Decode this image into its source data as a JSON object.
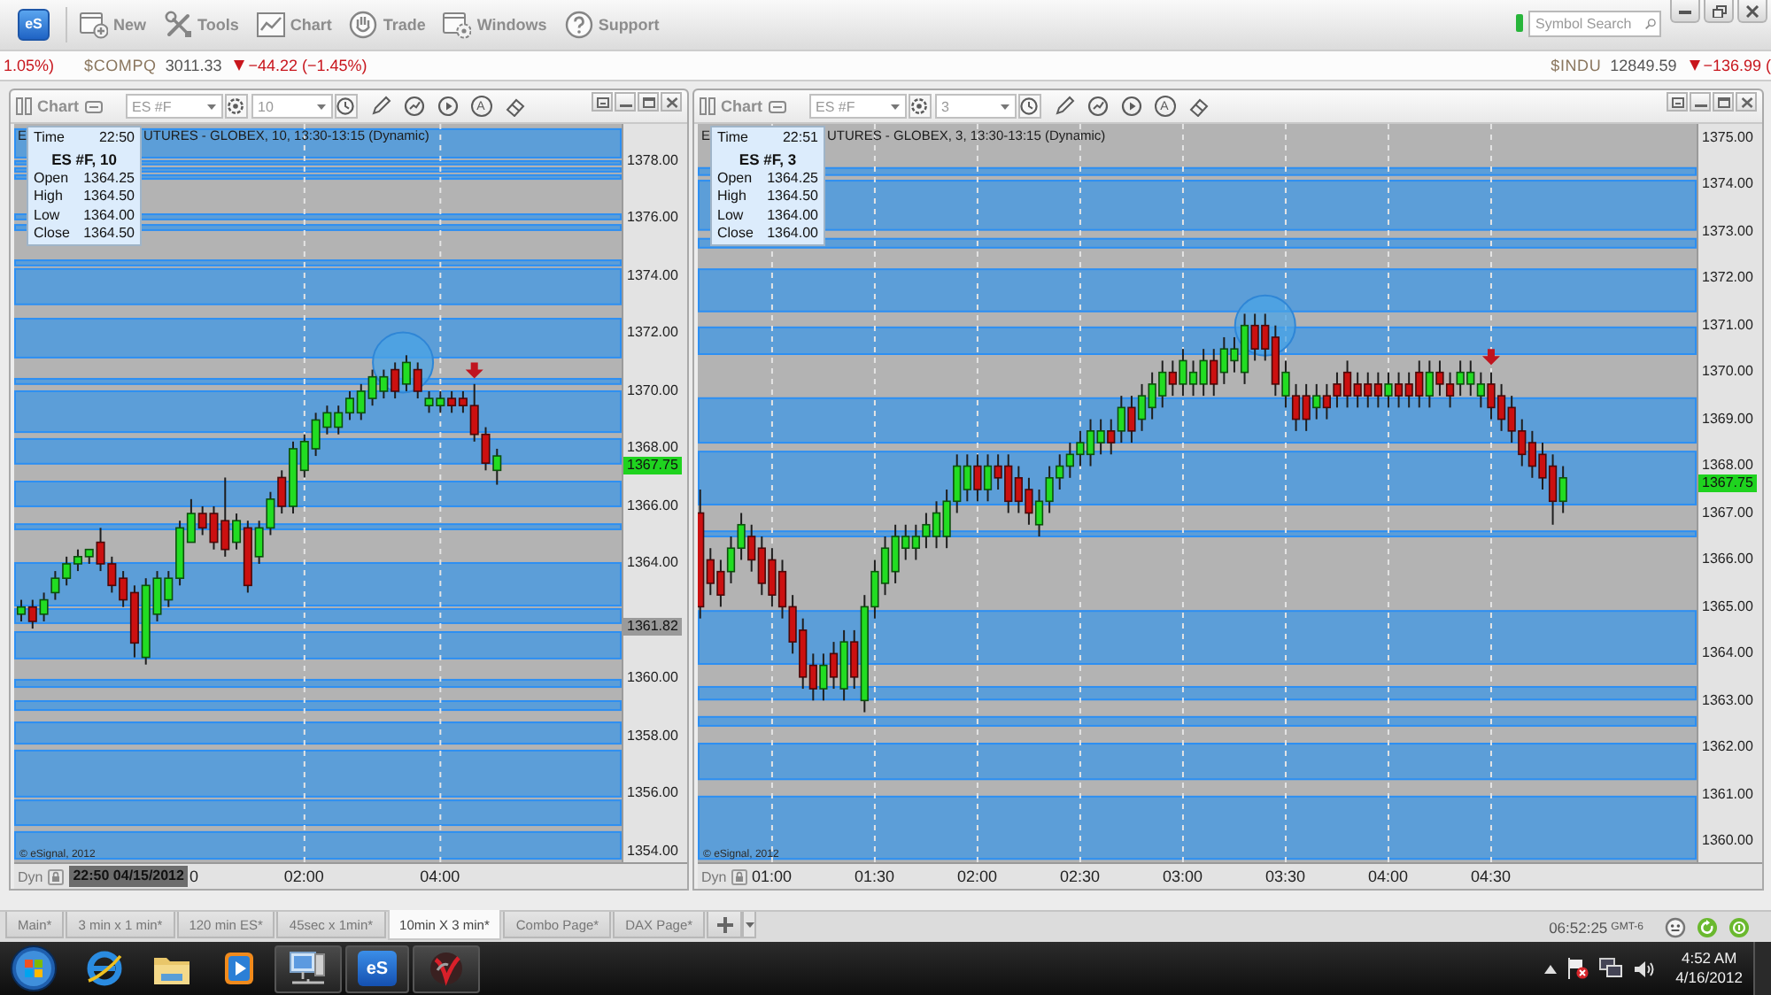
{
  "app_toolbar": {
    "logo": "eS",
    "buttons": [
      {
        "kind": "new",
        "label": "New"
      },
      {
        "kind": "tools",
        "label": "Tools"
      },
      {
        "kind": "chart",
        "label": "Chart"
      },
      {
        "kind": "trade",
        "label": "Trade"
      },
      {
        "kind": "windows",
        "label": "Windows"
      },
      {
        "kind": "support",
        "label": "Support"
      }
    ],
    "search": {
      "placeholder": "Symbol Search"
    }
  },
  "ticker": {
    "left": [
      {
        "kind": "tail",
        "text": "1.05%)",
        "down": true
      },
      {
        "kind": "quote",
        "symbol": "$COMPQ",
        "price": "3011.33",
        "change": "−44.22 (−1.45%)",
        "down": true
      }
    ],
    "right": [
      {
        "kind": "quote",
        "symbol": "$INDU",
        "price": "12849.59",
        "change": "−136.99 (",
        "down": true
      }
    ]
  },
  "charts": [
    {
      "header": {
        "label": "Chart",
        "symbol": "ES #F",
        "interval": "10",
        "text_tool": "A"
      },
      "title_start": "E",
      "title_rest": "UTURES - GLOBEX, 10, 13:30-13:15 (Dynamic)",
      "legend": {
        "time_label": "Time",
        "time": "22:50",
        "heading": "ES #F, 10",
        "rows": [
          {
            "label": "Open",
            "value": "1364.25"
          },
          {
            "label": "High",
            "value": "1364.50"
          },
          {
            "label": "Low",
            "value": "1364.00"
          },
          {
            "label": "Close",
            "value": "1364.50"
          }
        ]
      },
      "chart_data": {
        "type": "candlestick",
        "x": [
          -130,
          -120,
          -110,
          -100,
          -90,
          -80,
          -70,
          -60,
          -50,
          -40,
          -30,
          -20,
          -10,
          0,
          10,
          20,
          30,
          40,
          50,
          60,
          70,
          80,
          90,
          100,
          110,
          120,
          130,
          140,
          150,
          160,
          170,
          180,
          190,
          200,
          210,
          220,
          230,
          240,
          250,
          260,
          270,
          280,
          290
        ],
        "ohlc": [
          [
            1362.25,
            1362.75,
            1362,
            1362.5
          ],
          [
            1362.5,
            1362.75,
            1361.75,
            1362
          ],
          [
            1362.25,
            1363,
            1362,
            1362.75
          ],
          [
            1363,
            1363.75,
            1362.75,
            1363.5
          ],
          [
            1363.5,
            1364.25,
            1363.25,
            1364
          ],
          [
            1364,
            1364.5,
            1363.75,
            1364.25
          ],
          [
            1364.25,
            1364.5,
            1364,
            1364.5
          ],
          [
            1364.75,
            1365.25,
            1363.75,
            1364
          ],
          [
            1364,
            1364.25,
            1363,
            1363.25
          ],
          [
            1363.5,
            1363.75,
            1362.5,
            1362.75
          ],
          [
            1363,
            1363.25,
            1360.75,
            1361.25
          ],
          [
            1360.75,
            1363.5,
            1360.5,
            1363.25
          ],
          [
            1362.25,
            1363.75,
            1362,
            1363.5
          ],
          [
            1362.75,
            1363.75,
            1362.5,
            1363.5
          ],
          [
            1363.5,
            1365.5,
            1363.25,
            1365.25
          ],
          [
            1364.75,
            1366.25,
            1364.75,
            1365.75
          ],
          [
            1365.75,
            1366,
            1365,
            1365.25
          ],
          [
            1365.75,
            1366,
            1364.5,
            1364.75
          ],
          [
            1365.5,
            1367,
            1364.25,
            1364.5
          ],
          [
            1364.75,
            1365.75,
            1364.5,
            1365.5
          ],
          [
            1365.25,
            1365.5,
            1363,
            1363.25
          ],
          [
            1364.25,
            1365.5,
            1364,
            1365.25
          ],
          [
            1365.25,
            1366.5,
            1365,
            1366.25
          ],
          [
            1367,
            1367.25,
            1365.75,
            1366
          ],
          [
            1366,
            1368.25,
            1365.75,
            1368
          ],
          [
            1367.25,
            1368.5,
            1367,
            1368.25
          ],
          [
            1368,
            1369.25,
            1367.75,
            1369
          ],
          [
            1368.75,
            1369.5,
            1368.5,
            1369.25
          ],
          [
            1368.75,
            1369.5,
            1368.5,
            1369.25
          ],
          [
            1369.25,
            1370,
            1369,
            1369.75
          ],
          [
            1369.25,
            1370.25,
            1369,
            1370
          ],
          [
            1369.75,
            1370.75,
            1369.5,
            1370.5
          ],
          [
            1370,
            1370.75,
            1369.75,
            1370.5
          ],
          [
            1370.75,
            1371,
            1369.75,
            1370
          ],
          [
            1370.25,
            1371.25,
            1370,
            1371
          ],
          [
            1370.75,
            1371,
            1369.75,
            1370
          ],
          [
            1369.5,
            1370,
            1369.25,
            1369.75
          ],
          [
            1369.5,
            1370,
            1369.25,
            1369.75
          ],
          [
            1369.75,
            1370,
            1369.25,
            1369.5
          ],
          [
            1369.75,
            1370,
            1369.25,
            1369.5
          ],
          [
            1369.5,
            1370.25,
            1368.25,
            1368.5
          ],
          [
            1368.5,
            1368.75,
            1367.25,
            1367.5
          ],
          [
            1367.25,
            1368,
            1366.75,
            1367.75
          ]
        ],
        "xlim": [
          -136.25,
          457.84
        ],
        "ylim": [
          1353.63,
          1379.29
        ],
        "grid": true,
        "xticks": [
          {
            "value": 120,
            "label": "02:00"
          },
          {
            "value": 240,
            "label": "04:00"
          }
        ],
        "yticks": [
          {
            "value": 1378,
            "label": "1378.00"
          },
          {
            "value": 1376,
            "label": "1376.00"
          },
          {
            "value": 1374,
            "label": "1374.00"
          },
          {
            "value": 1372,
            "label": "1372.00"
          },
          {
            "value": 1370,
            "label": "1370.00"
          },
          {
            "value": 1368,
            "label": "1368.00"
          },
          {
            "value": 1366,
            "label": "1366.00"
          },
          {
            "value": 1364,
            "label": "1364.00"
          },
          {
            "value": 1361.82,
            "label": "1361.82"
          },
          {
            "value": 1360,
            "label": "1360.00"
          },
          {
            "value": 1358,
            "label": "1358.00"
          },
          {
            "value": 1356,
            "label": "1356.00"
          },
          {
            "value": 1354,
            "label": "1354.00"
          }
        ],
        "bands": [
          {
            "axis": "y",
            "from": 1378.12,
            "to": 1379.11
          },
          {
            "axis": "y",
            "from": 1377.88,
            "to": 1378.0
          },
          {
            "axis": "y",
            "from": 1377.63,
            "to": 1377.75
          },
          {
            "axis": "y",
            "from": 1377.38,
            "to": 1377.51
          },
          {
            "axis": "y",
            "from": 1375.97,
            "to": 1376.15
          },
          {
            "axis": "y",
            "from": 1375.6,
            "to": 1375.78
          },
          {
            "axis": "y",
            "from": 1374.37,
            "to": 1374.55
          },
          {
            "axis": "y",
            "from": 1373.02,
            "to": 1374.25
          },
          {
            "axis": "y",
            "from": 1371.17,
            "to": 1372.52
          },
          {
            "axis": "y",
            "from": 1370.25,
            "to": 1370.43
          },
          {
            "axis": "y",
            "from": 1368.58,
            "to": 1370.0
          },
          {
            "axis": "y",
            "from": 1367.48,
            "to": 1368.34
          },
          {
            "axis": "y",
            "from": 1366.0,
            "to": 1366.86
          },
          {
            "axis": "y",
            "from": 1365.2,
            "to": 1365.38
          },
          {
            "axis": "y",
            "from": 1362.55,
            "to": 1364.03
          },
          {
            "axis": "y",
            "from": 1361.94,
            "to": 1362.43
          },
          {
            "axis": "y",
            "from": 1360.71,
            "to": 1361.63
          },
          {
            "axis": "y",
            "from": 1359.72,
            "to": 1359.97
          },
          {
            "axis": "y",
            "from": 1358.92,
            "to": 1359.23
          },
          {
            "axis": "y",
            "from": 1357.75,
            "to": 1358.49
          },
          {
            "axis": "y",
            "from": 1355.91,
            "to": 1357.51
          },
          {
            "axis": "y",
            "from": 1354.92,
            "to": 1355.78
          },
          {
            "axis": "y",
            "from": 1353.75,
            "to": 1354.68
          }
        ],
        "annotations": [
          "1367.75"
        ]
      },
      "copyright": "© eSignal, 2012",
      "time_axis": {
        "mode": "Dyn",
        "cursor_time": "22:50 04/15/2012",
        "clipped_label": "0"
      }
    },
    {
      "header": {
        "label": "Chart",
        "symbol": "ES #F",
        "interval": "3",
        "text_tool": "A"
      },
      "title_start": "E",
      "title_rest": "UTURES - GLOBEX, 3, 13:30-13:15 (Dynamic)",
      "legend": {
        "time_label": "Time",
        "time": "22:51",
        "heading": "ES #F, 3",
        "rows": [
          {
            "label": "Open",
            "value": "1364.25"
          },
          {
            "label": "High",
            "value": "1364.50"
          },
          {
            "label": "Low",
            "value": "1364.00"
          },
          {
            "label": "Close",
            "value": "1364.00"
          }
        ]
      },
      "chart_data": {
        "type": "candlestick",
        "x": [
          39,
          42,
          45,
          48,
          51,
          54,
          57,
          60,
          63,
          66,
          69,
          72,
          75,
          78,
          81,
          84,
          87,
          90,
          93,
          96,
          99,
          102,
          105,
          108,
          111,
          114,
          117,
          120,
          123,
          126,
          129,
          132,
          135,
          138,
          141,
          144,
          147,
          150,
          153,
          156,
          159,
          162,
          165,
          168,
          171,
          174,
          177,
          180,
          183,
          186,
          189,
          192,
          195,
          198,
          201,
          204,
          207,
          210,
          213,
          216,
          219,
          222,
          225,
          228,
          231,
          234,
          237,
          240,
          243,
          246,
          249,
          252,
          255,
          258,
          261,
          264,
          267,
          270,
          273,
          276,
          279,
          282,
          285,
          288,
          291
        ],
        "ohlc": [
          [
            1367,
            1367.5,
            1364.75,
            1365
          ],
          [
            1366,
            1366.25,
            1365.25,
            1365.5
          ],
          [
            1365.75,
            1366,
            1365,
            1365.25
          ],
          [
            1365.75,
            1366.5,
            1365.5,
            1366.25
          ],
          [
            1366.25,
            1367,
            1366,
            1366.75
          ],
          [
            1366.5,
            1366.75,
            1365.75,
            1366
          ],
          [
            1366.25,
            1366.5,
            1365.25,
            1365.5
          ],
          [
            1366,
            1366.25,
            1365,
            1365.25
          ],
          [
            1365.75,
            1366,
            1364.75,
            1365
          ],
          [
            1365,
            1365.25,
            1364,
            1364.25
          ],
          [
            1364.5,
            1364.75,
            1363.25,
            1363.5
          ],
          [
            1363.75,
            1364,
            1363,
            1363.25
          ],
          [
            1363.25,
            1364,
            1363,
            1363.75
          ],
          [
            1364,
            1364.25,
            1363.25,
            1363.5
          ],
          [
            1363.25,
            1364.5,
            1363,
            1364.25
          ],
          [
            1364.25,
            1364.5,
            1363.25,
            1363.5
          ],
          [
            1363,
            1365.25,
            1362.75,
            1365
          ],
          [
            1365,
            1366,
            1364.75,
            1365.75
          ],
          [
            1365.5,
            1366.5,
            1365.25,
            1366.25
          ],
          [
            1365.75,
            1366.75,
            1365.5,
            1366.5
          ],
          [
            1366.25,
            1366.75,
            1366,
            1366.5
          ],
          [
            1366.25,
            1366.75,
            1366,
            1366.5
          ],
          [
            1366.5,
            1367,
            1366.25,
            1366.75
          ],
          [
            1366.5,
            1367.25,
            1366.25,
            1367
          ],
          [
            1366.5,
            1367.5,
            1366.25,
            1367.25
          ],
          [
            1367.25,
            1368.25,
            1367,
            1368
          ],
          [
            1367.5,
            1368.25,
            1367.25,
            1368
          ],
          [
            1368,
            1368.25,
            1367.25,
            1367.5
          ],
          [
            1367.5,
            1368.25,
            1367.25,
            1368
          ],
          [
            1368,
            1368.25,
            1367.5,
            1367.75
          ],
          [
            1368,
            1368.25,
            1367,
            1367.25
          ],
          [
            1367.75,
            1368,
            1367,
            1367.25
          ],
          [
            1367.5,
            1367.75,
            1366.75,
            1367
          ],
          [
            1366.75,
            1367.5,
            1366.5,
            1367.25
          ],
          [
            1367.25,
            1368,
            1367,
            1367.75
          ],
          [
            1367.75,
            1368.25,
            1367.5,
            1368
          ],
          [
            1368,
            1368.5,
            1367.75,
            1368.25
          ],
          [
            1368.25,
            1368.75,
            1368,
            1368.5
          ],
          [
            1368.25,
            1369,
            1368,
            1368.75
          ],
          [
            1368.5,
            1369,
            1368.25,
            1368.75
          ],
          [
            1368.75,
            1369,
            1368.25,
            1368.5
          ],
          [
            1368.75,
            1369.5,
            1368.5,
            1369.25
          ],
          [
            1369.25,
            1369.5,
            1368.5,
            1368.75
          ],
          [
            1369,
            1369.75,
            1368.75,
            1369.5
          ],
          [
            1369.25,
            1370,
            1369,
            1369.75
          ],
          [
            1369.5,
            1370.25,
            1369.25,
            1370
          ],
          [
            1370,
            1370.25,
            1369.5,
            1369.75
          ],
          [
            1369.75,
            1370.5,
            1369.5,
            1370.25
          ],
          [
            1369.75,
            1370.25,
            1369.5,
            1370
          ],
          [
            1369.75,
            1370.5,
            1369.5,
            1370.25
          ],
          [
            1370.25,
            1370.5,
            1369.5,
            1369.75
          ],
          [
            1370,
            1370.75,
            1369.75,
            1370.5
          ],
          [
            1370.25,
            1370.75,
            1370,
            1370.5
          ],
          [
            1370,
            1371.25,
            1369.75,
            1371
          ],
          [
            1371,
            1371.25,
            1370.25,
            1370.5
          ],
          [
            1371,
            1371.25,
            1370.25,
            1370.5
          ],
          [
            1370.75,
            1371,
            1369.5,
            1369.75
          ],
          [
            1369.5,
            1370.25,
            1369.25,
            1370
          ],
          [
            1369.5,
            1369.75,
            1368.75,
            1369
          ],
          [
            1369.5,
            1369.75,
            1368.75,
            1369
          ],
          [
            1369.25,
            1369.75,
            1369,
            1369.5
          ],
          [
            1369.5,
            1369.75,
            1369,
            1369.25
          ],
          [
            1369.75,
            1370,
            1369.25,
            1369.5
          ],
          [
            1370,
            1370.25,
            1369.25,
            1369.5
          ],
          [
            1369.75,
            1370,
            1369.25,
            1369.5
          ],
          [
            1369.75,
            1370,
            1369.25,
            1369.5
          ],
          [
            1369.75,
            1370,
            1369.25,
            1369.5
          ],
          [
            1369.5,
            1370,
            1369.25,
            1369.75
          ],
          [
            1369.75,
            1370,
            1369.25,
            1369.5
          ],
          [
            1369.75,
            1370,
            1369.25,
            1369.5
          ],
          [
            1370,
            1370.25,
            1369.25,
            1369.5
          ],
          [
            1369.5,
            1370.25,
            1369.25,
            1370
          ],
          [
            1370,
            1370.25,
            1369.5,
            1369.75
          ],
          [
            1369.75,
            1370,
            1369.25,
            1369.5
          ],
          [
            1369.75,
            1370.25,
            1369.5,
            1370
          ],
          [
            1369.75,
            1370.25,
            1369.5,
            1370
          ],
          [
            1369.5,
            1370,
            1369.25,
            1369.75
          ],
          [
            1369.75,
            1370,
            1369,
            1369.25
          ],
          [
            1369.5,
            1369.75,
            1368.75,
            1369
          ],
          [
            1369.25,
            1369.5,
            1368.5,
            1368.75
          ],
          [
            1368.75,
            1369,
            1368,
            1368.25
          ],
          [
            1368.5,
            1368.75,
            1367.75,
            1368
          ],
          [
            1368.25,
            1368.5,
            1367.5,
            1367.75
          ],
          [
            1368,
            1368.25,
            1366.75,
            1367.25
          ],
          [
            1367.25,
            1368,
            1367,
            1367.75
          ]
        ],
        "xlim": [
          38.3,
          349.14
        ],
        "ylim": [
          1359.55,
          1375.3
        ],
        "grid": true,
        "xticks": [
          {
            "value": 60,
            "label": "01:00"
          },
          {
            "value": 90,
            "label": "01:30"
          },
          {
            "value": 120,
            "label": "02:00"
          },
          {
            "value": 150,
            "label": "02:30"
          },
          {
            "value": 180,
            "label": "03:00"
          },
          {
            "value": 210,
            "label": "03:30"
          },
          {
            "value": 240,
            "label": "04:00"
          },
          {
            "value": 270,
            "label": "04:30"
          }
        ],
        "yticks": [
          {
            "value": 1375,
            "label": "1375.00"
          },
          {
            "value": 1374,
            "label": "1374.00"
          },
          {
            "value": 1373,
            "label": "1373.00"
          },
          {
            "value": 1372,
            "label": "1372.00"
          },
          {
            "value": 1371,
            "label": "1371.00"
          },
          {
            "value": 1370,
            "label": "1370.00"
          },
          {
            "value": 1369,
            "label": "1369.00"
          },
          {
            "value": 1368,
            "label": "1368.00"
          },
          {
            "value": 1367,
            "label": "1367.00"
          },
          {
            "value": 1366,
            "label": "1366.00"
          },
          {
            "value": 1365,
            "label": "1365.00"
          },
          {
            "value": 1364,
            "label": "1364.00"
          },
          {
            "value": 1363,
            "label": "1363.00"
          },
          {
            "value": 1362,
            "label": "1362.00"
          },
          {
            "value": 1361,
            "label": "1361.00"
          },
          {
            "value": 1360,
            "label": "1360.00"
          }
        ],
        "bands": [
          {
            "axis": "y",
            "from": 1374.21,
            "to": 1374.36
          },
          {
            "axis": "y",
            "from": 1373.04,
            "to": 1374.09
          },
          {
            "axis": "y",
            "from": 1372.66,
            "to": 1372.85
          },
          {
            "axis": "y",
            "from": 1371.3,
            "to": 1372.2
          },
          {
            "axis": "y",
            "from": 1370.39,
            "to": 1370.96
          },
          {
            "axis": "y",
            "from": 1368.5,
            "to": 1369.45
          },
          {
            "axis": "y",
            "from": 1367.18,
            "to": 1368.31
          },
          {
            "axis": "y",
            "from": 1366.5,
            "to": 1366.61
          },
          {
            "axis": "y",
            "from": 1363.78,
            "to": 1364.91
          },
          {
            "axis": "y",
            "from": 1363.02,
            "to": 1363.29
          },
          {
            "axis": "y",
            "from": 1362.46,
            "to": 1362.65
          },
          {
            "axis": "y",
            "from": 1361.32,
            "to": 1362.08
          },
          {
            "axis": "y",
            "from": 1359.62,
            "to": 1360.95
          }
        ],
        "annotations": [
          "1367.75"
        ]
      },
      "copyright": "© eSignal, 2012",
      "time_axis": {
        "mode": "Dyn"
      }
    }
  ],
  "page_tabs": [
    {
      "label": "Main*",
      "selected": false
    },
    {
      "label": "3 min x 1 min*",
      "selected": false
    },
    {
      "label": "120 min ES*",
      "selected": false
    },
    {
      "label": "45sec x 1min*",
      "selected": false
    },
    {
      "label": "10min X 3 min*",
      "selected": true
    },
    {
      "label": "Combo Page*",
      "selected": false
    },
    {
      "label": "DAX Page*",
      "selected": false
    }
  ],
  "status_bar": {
    "time": "06:52:25",
    "zone": "GMT-6"
  },
  "taskbar": {
    "pinned_app_label": "eS",
    "clock": {
      "time": "4:52 AM",
      "date": "4/16/2012"
    }
  }
}
